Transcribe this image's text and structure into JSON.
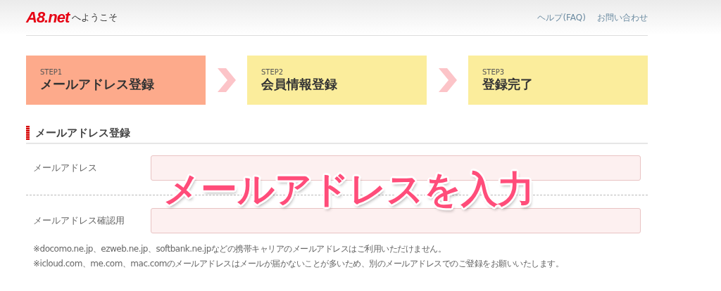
{
  "header": {
    "logo": "A8.net",
    "welcome": "へようこそ",
    "links": [
      "ヘルプ(FAQ)",
      "お問い合わせ"
    ]
  },
  "steps": [
    {
      "step": "STEP1",
      "label": "メールアドレス登録",
      "selected": true
    },
    {
      "step": "STEP2",
      "label": "会員情報登録",
      "selected": false
    },
    {
      "step": "STEP3",
      "label": "登録完了",
      "selected": false
    }
  ],
  "section_title": "メールアドレス登録",
  "fields": [
    {
      "label": "メールアドレス"
    },
    {
      "label": "メールアドレス確認用"
    }
  ],
  "notes": [
    "※docomo.ne.jp、ezweb.ne.jp、softbank.ne.jpなどの携帯キャリアのメールアドレスはご利用いただけません。",
    "※icloud.com、me.com、mac.comのメールアドレスはメールが届かないことが多いため、別のメールアドレスでのご登録をお願いいたします。"
  ],
  "overlay_caption": "メールアドレスを入力"
}
